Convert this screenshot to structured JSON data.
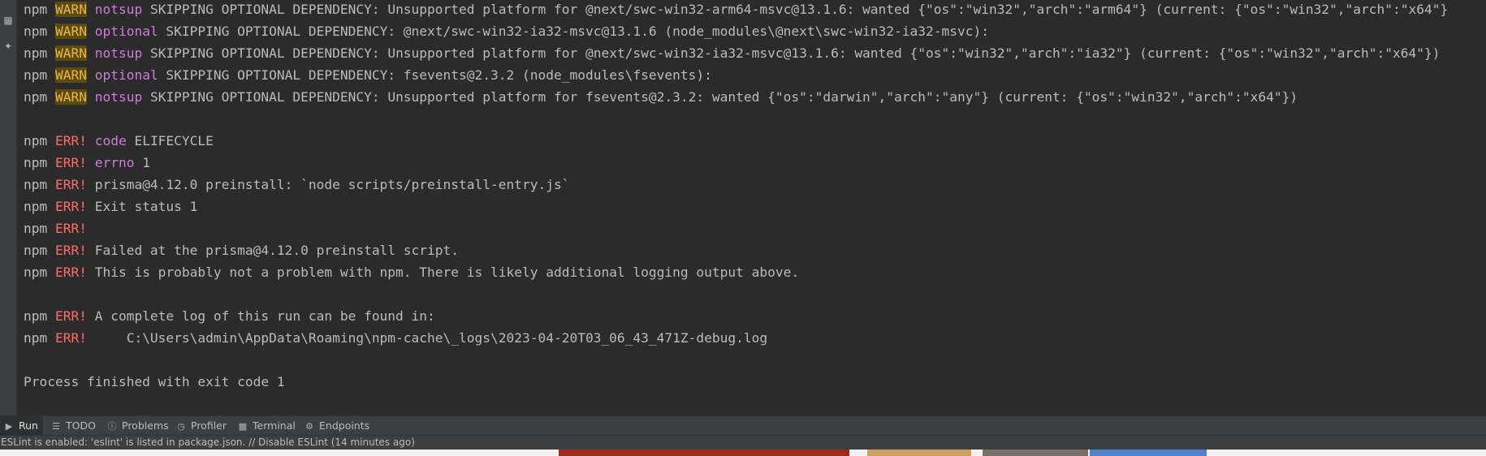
{
  "console": {
    "lines": [
      [
        {
          "t": "npm "
        },
        {
          "t": "WARN",
          "s": "warn"
        },
        {
          "t": " "
        },
        {
          "t": "notsup",
          "s": "kw"
        },
        {
          "t": " SKIPPING OPTIONAL DEPENDENCY: Unsupported platform for @next/swc-win32-arm64-msvc@13.1.6: wanted {\"os\":\"win32\",\"arch\":\"arm64\"} (current: {\"os\":\"win32\",\"arch\":\"x64\"}"
        }
      ],
      [
        {
          "t": "npm "
        },
        {
          "t": "WARN",
          "s": "warn"
        },
        {
          "t": " "
        },
        {
          "t": "optional",
          "s": "kw"
        },
        {
          "t": " SKIPPING OPTIONAL DEPENDENCY: @next/swc-win32-ia32-msvc@13.1.6 (node_modules\\@next\\swc-win32-ia32-msvc):"
        }
      ],
      [
        {
          "t": "npm "
        },
        {
          "t": "WARN",
          "s": "warn"
        },
        {
          "t": " "
        },
        {
          "t": "notsup",
          "s": "kw"
        },
        {
          "t": " SKIPPING OPTIONAL DEPENDENCY: Unsupported platform for @next/swc-win32-ia32-msvc@13.1.6: wanted {\"os\":\"win32\",\"arch\":\"ia32\"} (current: {\"os\":\"win32\",\"arch\":\"x64\"})"
        }
      ],
      [
        {
          "t": "npm "
        },
        {
          "t": "WARN",
          "s": "warn"
        },
        {
          "t": " "
        },
        {
          "t": "optional",
          "s": "kw"
        },
        {
          "t": " SKIPPING OPTIONAL DEPENDENCY: fsevents@2.3.2 (node_modules\\fsevents):"
        }
      ],
      [
        {
          "t": "npm "
        },
        {
          "t": "WARN",
          "s": "warn"
        },
        {
          "t": " "
        },
        {
          "t": "notsup",
          "s": "kw"
        },
        {
          "t": " SKIPPING OPTIONAL DEPENDENCY: Unsupported platform for fsevents@2.3.2: wanted {\"os\":\"darwin\",\"arch\":\"any\"} (current: {\"os\":\"win32\",\"arch\":\"x64\"})"
        }
      ],
      [],
      [
        {
          "t": "npm "
        },
        {
          "t": "ERR!",
          "s": "err"
        },
        {
          "t": " "
        },
        {
          "t": "code",
          "s": "kw"
        },
        {
          "t": " ELIFECYCLE"
        }
      ],
      [
        {
          "t": "npm "
        },
        {
          "t": "ERR!",
          "s": "err"
        },
        {
          "t": " "
        },
        {
          "t": "errno",
          "s": "kw"
        },
        {
          "t": " 1"
        }
      ],
      [
        {
          "t": "npm "
        },
        {
          "t": "ERR!",
          "s": "err"
        },
        {
          "t": " prisma@4.12.0 preinstall: `node scripts/preinstall-entry.js`"
        }
      ],
      [
        {
          "t": "npm "
        },
        {
          "t": "ERR!",
          "s": "err"
        },
        {
          "t": " Exit status 1"
        }
      ],
      [
        {
          "t": "npm "
        },
        {
          "t": "ERR!",
          "s": "err"
        }
      ],
      [
        {
          "t": "npm "
        },
        {
          "t": "ERR!",
          "s": "err"
        },
        {
          "t": " Failed at the prisma@4.12.0 preinstall script."
        }
      ],
      [
        {
          "t": "npm "
        },
        {
          "t": "ERR!",
          "s": "err"
        },
        {
          "t": " This is probably not a problem with npm. There is likely additional logging output above."
        }
      ],
      [],
      [
        {
          "t": "npm "
        },
        {
          "t": "ERR!",
          "s": "err"
        },
        {
          "t": " A complete log of this run can be found in:"
        }
      ],
      [
        {
          "t": "npm "
        },
        {
          "t": "ERR!",
          "s": "err"
        },
        {
          "t": "     C:\\Users\\admin\\AppData\\Roaming\\npm-cache\\_logs\\2023-04-20T03_06_43_471Z-debug.log"
        }
      ],
      [],
      [
        {
          "t": "Process finished with exit code 1"
        }
      ]
    ]
  },
  "gutter": {
    "icons": [
      "layout-icon",
      "pin-icon"
    ]
  },
  "toolwindow_tabs": [
    {
      "label": "Run",
      "icon": "run-icon",
      "active": true
    },
    {
      "label": "TODO",
      "icon": "todo-icon",
      "active": false
    },
    {
      "label": "Problems",
      "icon": "problems-icon",
      "active": false
    },
    {
      "label": "Profiler",
      "icon": "profiler-icon",
      "active": false
    },
    {
      "label": "Terminal",
      "icon": "terminal-icon",
      "active": false
    },
    {
      "label": "Endpoints",
      "icon": "endpoints-icon",
      "active": false
    }
  ],
  "statusbar": {
    "message": "ESLint is enabled: 'eslint' is listed in package.json. // Disable ESLint (14 minutes ago)"
  },
  "colors": {
    "background": "#2b2b2b",
    "panel": "#3c3f41",
    "text": "#bbbbbb",
    "warn_fg": "#e8b84b",
    "warn_bg": "#5c4a0f",
    "err": "#ff6b68",
    "keyword": "#cc7dd8"
  }
}
